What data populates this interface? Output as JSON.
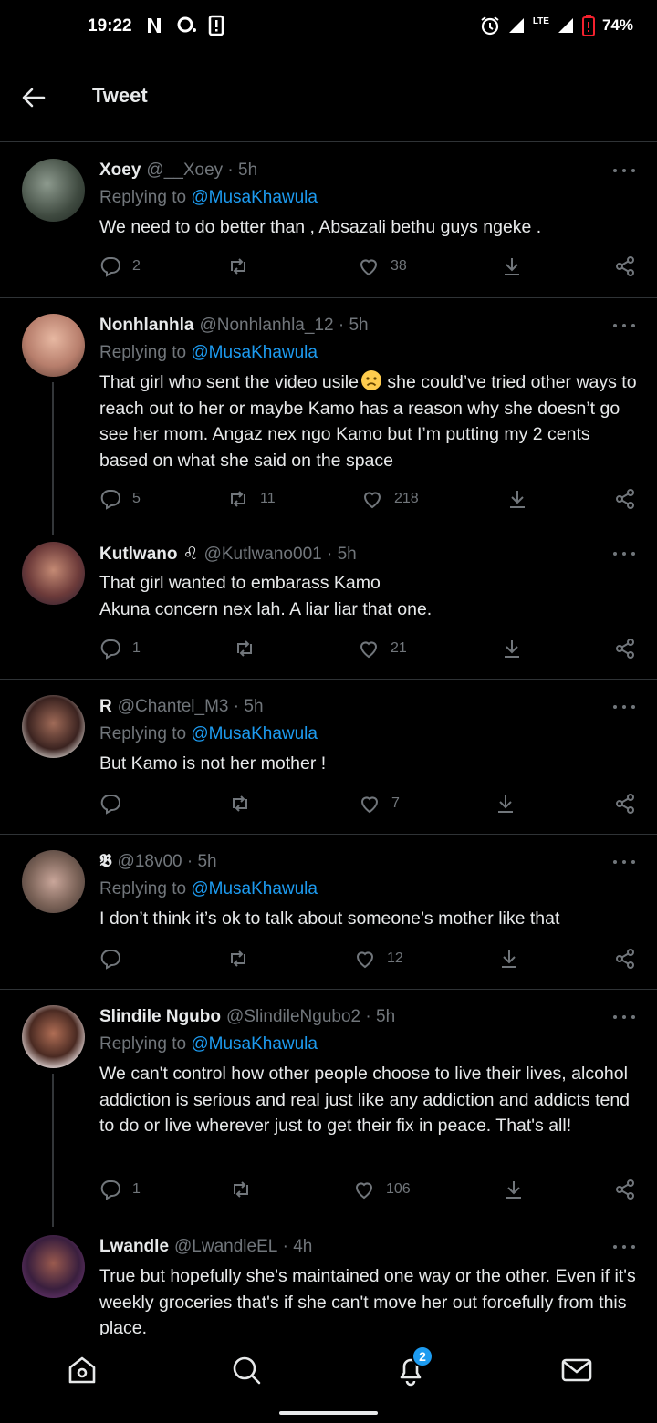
{
  "status_bar": {
    "time": "19:22",
    "battery": "74%",
    "network": "LTE"
  },
  "header": {
    "title": "Tweet"
  },
  "tweets": [
    {
      "name": "Xoey",
      "handle": "@__Xoey",
      "time": "5h",
      "replying_prefix": "Replying to",
      "replying_to": "@MusaKhawula",
      "text": "We need to do better than , Absazali bethu guys ngeke .",
      "replies": "2",
      "retweets": "",
      "likes": "38"
    },
    {
      "name": "Nonhlanhla",
      "handle": "@Nonhlanhla_12",
      "time": "5h",
      "replying_prefix": "Replying to",
      "replying_to": "@MusaKhawula",
      "text_before": "That girl who sent the video usile",
      "text_after": " she could’ve tried other ways to reach out to her or maybe Kamo has a reason why she doesn’t go see her mom. Angaz nex ngo Kamo but I’m putting my 2 cents based on what she said on the space",
      "replies": "5",
      "retweets": "11",
      "likes": "218"
    },
    {
      "name": "Kutlwano",
      "emoji": "♌",
      "handle": "@Kutlwano001",
      "time": "5h",
      "text_line1": "That girl wanted to embarass Kamo",
      "text_line2": "Akuna concern nex lah. A liar liar that one.",
      "replies": "1",
      "retweets": "",
      "likes": "21"
    },
    {
      "name": "R",
      "handle": "@Chantel_M3",
      "time": "5h",
      "replying_prefix": "Replying to",
      "replying_to": "@MusaKhawula",
      "text": "But Kamo is not her mother !",
      "replies": "",
      "retweets": "",
      "likes": "7"
    },
    {
      "name": "𝕭",
      "handle": "@18v00",
      "time": "5h",
      "replying_prefix": "Replying to",
      "replying_to": "@MusaKhawula",
      "text": "I don’t think it’s ok to talk about someone’s mother like that",
      "replies": "",
      "retweets": "",
      "likes": "12"
    },
    {
      "name": "Slindile Ngubo",
      "handle": "@SlindileNgubo2",
      "time": "5h",
      "replying_prefix": "Replying to",
      "replying_to": "@MusaKhawula",
      "text": "We can't control how other people choose to live their lives, alcohol addiction is serious and real just like any addiction and addicts tend to do or live wherever just to get their fix in peace. That's all!",
      "replies": "1",
      "retweets": "",
      "likes": "106"
    },
    {
      "name": "Lwandle",
      "handle": "@LwandleEL",
      "time": "4h",
      "text": "True but hopefully she's maintained one way or the other. Even if it's weekly groceries that's if she can't move her out forcefully from this place."
    }
  ],
  "bottom_nav": {
    "notification_count": "2"
  },
  "colors": {
    "background": "#000000",
    "accent": "#1d9bf0",
    "muted": "#71767b",
    "divider": "#2f3336"
  }
}
